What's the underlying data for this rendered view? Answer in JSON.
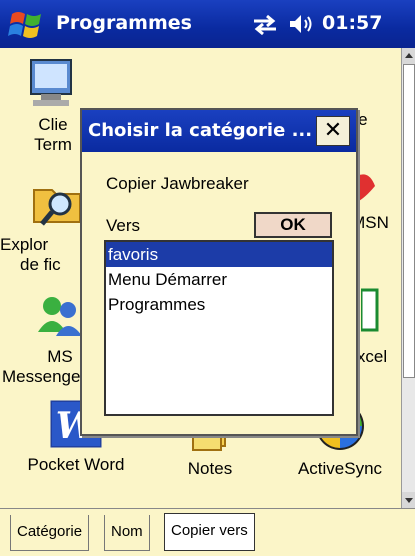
{
  "titlebar": {
    "title": "Programmes",
    "time": "01:57"
  },
  "desktop": {
    "apps": [
      {
        "label_line1": "Clie",
        "label_line2": "Term",
        "icon": "terminal-services-icon"
      },
      {
        "label_line1": "re",
        "label_line2": "",
        "icon": "unknown-app-icon"
      },
      {
        "label_line1": "Explor",
        "label_line2": "de fic",
        "icon": "file-explorer-icon"
      },
      {
        "label_line1": "MSN",
        "label_line2": "",
        "icon": "msn-icon"
      },
      {
        "label_line1": "MS",
        "label_line2": "Messenger",
        "icon": "messenger-icon"
      },
      {
        "label_line1": "xcel",
        "label_line2": "",
        "icon": "excel-icon"
      },
      {
        "label_line1": "Pocket Word",
        "label_line2": "",
        "icon": "pocket-word-icon"
      },
      {
        "label_line1": "Notes",
        "label_line2": "",
        "icon": "notes-icon"
      },
      {
        "label_line1": "ActiveSync",
        "label_line2": "",
        "icon": "activesync-icon"
      }
    ]
  },
  "dialog": {
    "title": "Choisir la catégorie ...",
    "close_glyph": "✕",
    "copy_label": "Copier Jawbreaker",
    "to_label": "Vers",
    "ok_label": "OK",
    "categories": [
      "favoris",
      "Menu Démarrer",
      "Programmes"
    ],
    "selected_index": 0
  },
  "tabs": {
    "items": [
      "Catégorie",
      "Nom",
      "Copier vers"
    ],
    "active_index": 2
  },
  "colors": {
    "titlebar": "#0a2aa0",
    "background": "#fbf5c8",
    "selection": "#1c3ca8"
  }
}
